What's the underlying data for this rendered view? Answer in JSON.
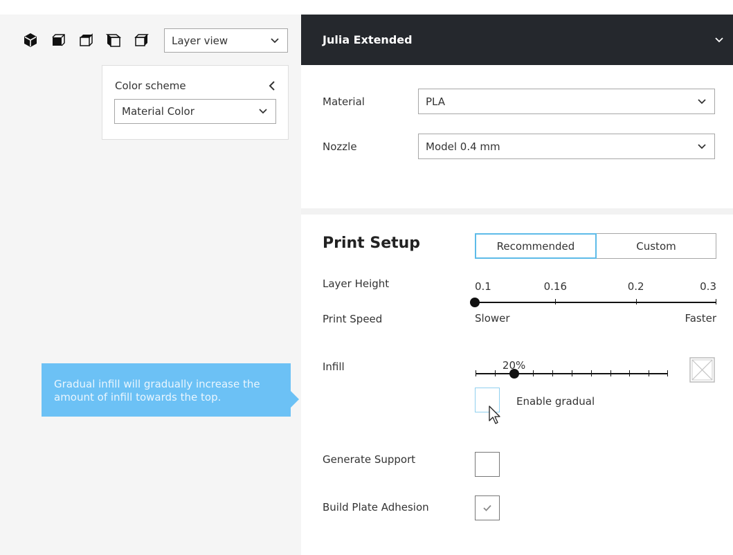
{
  "viewport": {
    "view_buttons": [
      {
        "name": "3d-view",
        "icon": "cube-3d-icon"
      },
      {
        "name": "front-view",
        "icon": "cube-front-icon"
      },
      {
        "name": "top-view",
        "icon": "cube-top-icon"
      },
      {
        "name": "left-view",
        "icon": "cube-left-icon"
      },
      {
        "name": "right-view",
        "icon": "cube-right-icon"
      }
    ],
    "view_mode": {
      "selected": "Layer view"
    },
    "color_scheme": {
      "title": "Color scheme",
      "selected": "Material Color"
    },
    "tooltip": {
      "text": "Gradual infill will gradually increase the amount of infill towards the top.",
      "color": "#6cc1f5"
    }
  },
  "sidebar": {
    "printer": {
      "name": "Julia Extended"
    },
    "material": {
      "label": "Material",
      "selected": "PLA"
    },
    "nozzle": {
      "label": "Nozzle",
      "selected": "Model 0.4 mm"
    },
    "print_setup": {
      "title": "Print Setup",
      "tabs": [
        {
          "label": "Recommended",
          "active": true
        },
        {
          "label": "Custom",
          "active": false
        }
      ],
      "layer_height": {
        "label": "Layer Height",
        "ticks": [
          "0.1",
          "0.16",
          "0.2",
          "0.3"
        ],
        "selected_index": 0
      },
      "print_speed": {
        "label": "Print Speed",
        "min_label": "Slower",
        "max_label": "Faster"
      },
      "infill": {
        "label": "Infill",
        "value_label": "20%",
        "value_percent": 20,
        "tick_count": 11,
        "gradual_label": "Enable gradual",
        "gradual_checked": false
      },
      "generate_support": {
        "label": "Generate Support",
        "checked": false
      },
      "build_plate_adhesion": {
        "label": "Build Plate Adhesion",
        "checked": true
      }
    },
    "accent_color": "#5dbbe8",
    "header_color": "#25282d"
  }
}
